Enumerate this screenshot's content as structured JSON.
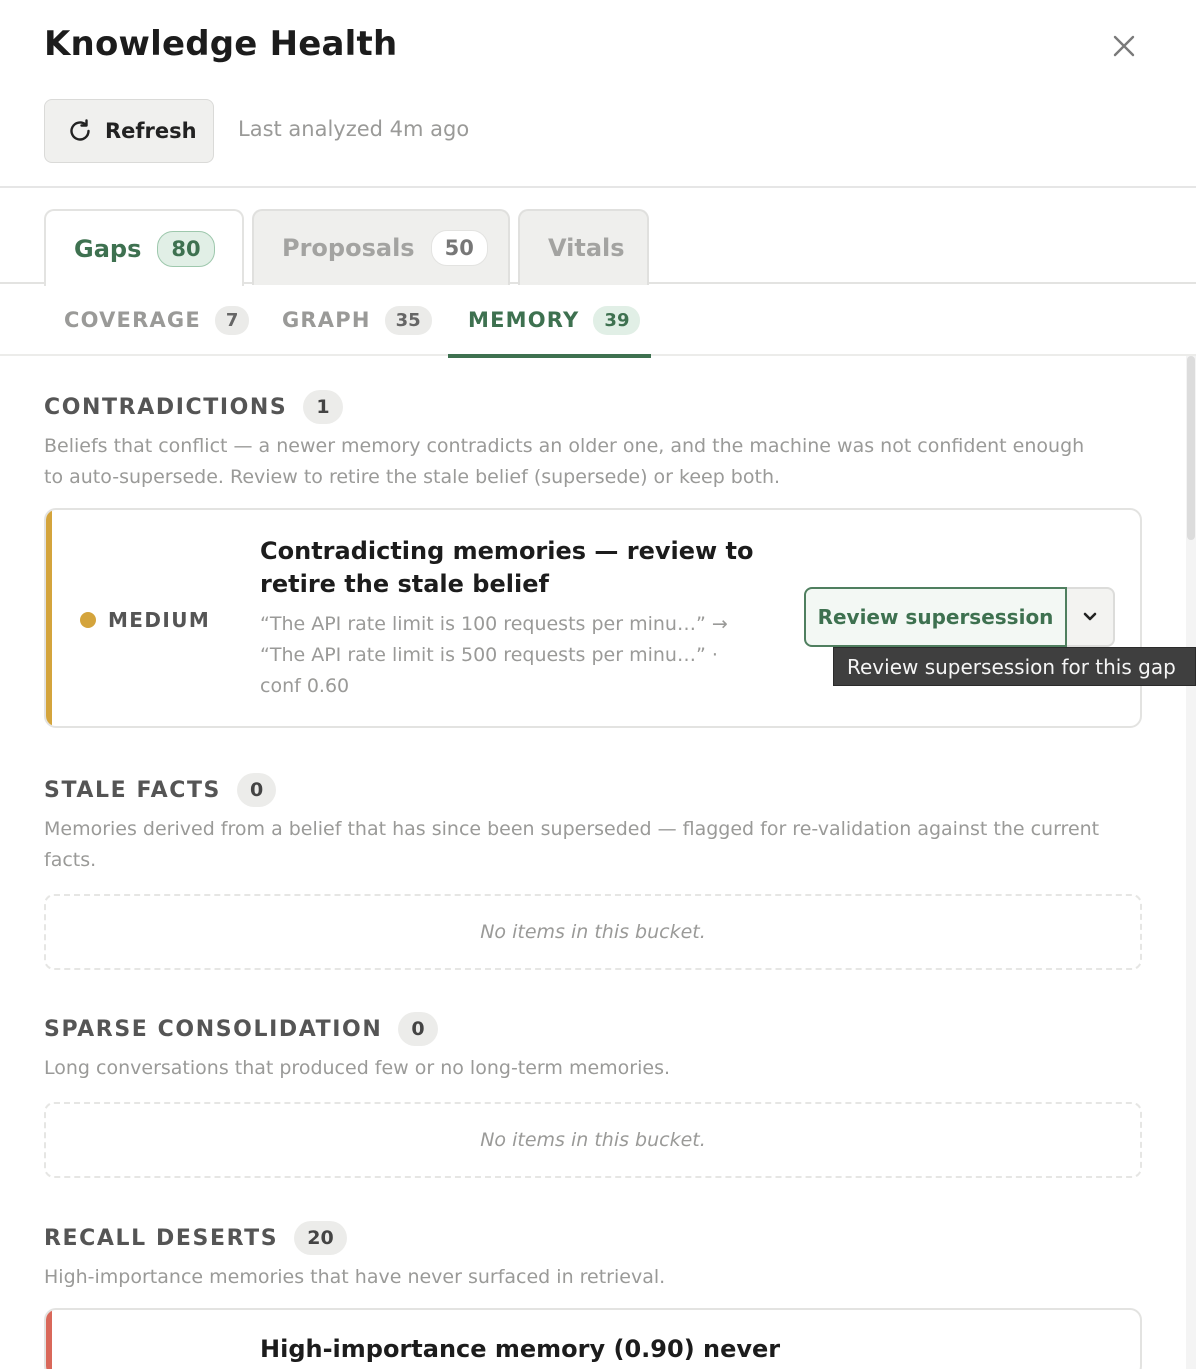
{
  "header": {
    "title": "Knowledge Health",
    "refresh_label": "Refresh",
    "last_analyzed": "Last analyzed 4m ago"
  },
  "tabs": [
    {
      "label": "Gaps",
      "count": "80",
      "active": true
    },
    {
      "label": "Proposals",
      "count": "50",
      "active": false
    },
    {
      "label": "Vitals",
      "active": false
    }
  ],
  "subtabs": [
    {
      "label": "COVERAGE",
      "count": "7",
      "active": false
    },
    {
      "label": "GRAPH",
      "count": "35",
      "active": false
    },
    {
      "label": "MEMORY",
      "count": "39",
      "active": true
    }
  ],
  "sections": {
    "contradictions": {
      "title": "CONTRADICTIONS",
      "count": "1",
      "description": "Beliefs that conflict — a newer memory contradicts an older one, and the machine was not confident enough to auto-supersede. Review to retire the stale belief (supersede) or keep both.",
      "items": [
        {
          "severity": "MEDIUM",
          "severity_color": "#d4a43c",
          "title": "Contradicting memories — review to retire the stale belief",
          "detail": "“The API rate limit is 100 requests per minu…” → “The API rate limit is 500 requests per minu…” · conf 0.60",
          "action_label": "Review supersession",
          "tooltip": "Review supersession for this gap"
        }
      ]
    },
    "stale_facts": {
      "title": "STALE FACTS",
      "count": "0",
      "description": "Memories derived from a belief that has since been superseded — flagged for re-validation against the current facts.",
      "empty_text": "No items in this bucket."
    },
    "sparse_consolidation": {
      "title": "SPARSE CONSOLIDATION",
      "count": "0",
      "description": "Long conversations that produced few or no long-term memories.",
      "empty_text": "No items in this bucket."
    },
    "recall_deserts": {
      "title": "RECALL DESERTS",
      "count": "20",
      "description": "High-importance memories that have never surfaced in retrieval.",
      "items": [
        {
          "severity_color": "#d9685a",
          "title": "High-importance memory (0.90) never"
        }
      ]
    }
  },
  "colors": {
    "accent": "#3e7150",
    "medium": "#d4a43c",
    "high": "#d9685a"
  }
}
